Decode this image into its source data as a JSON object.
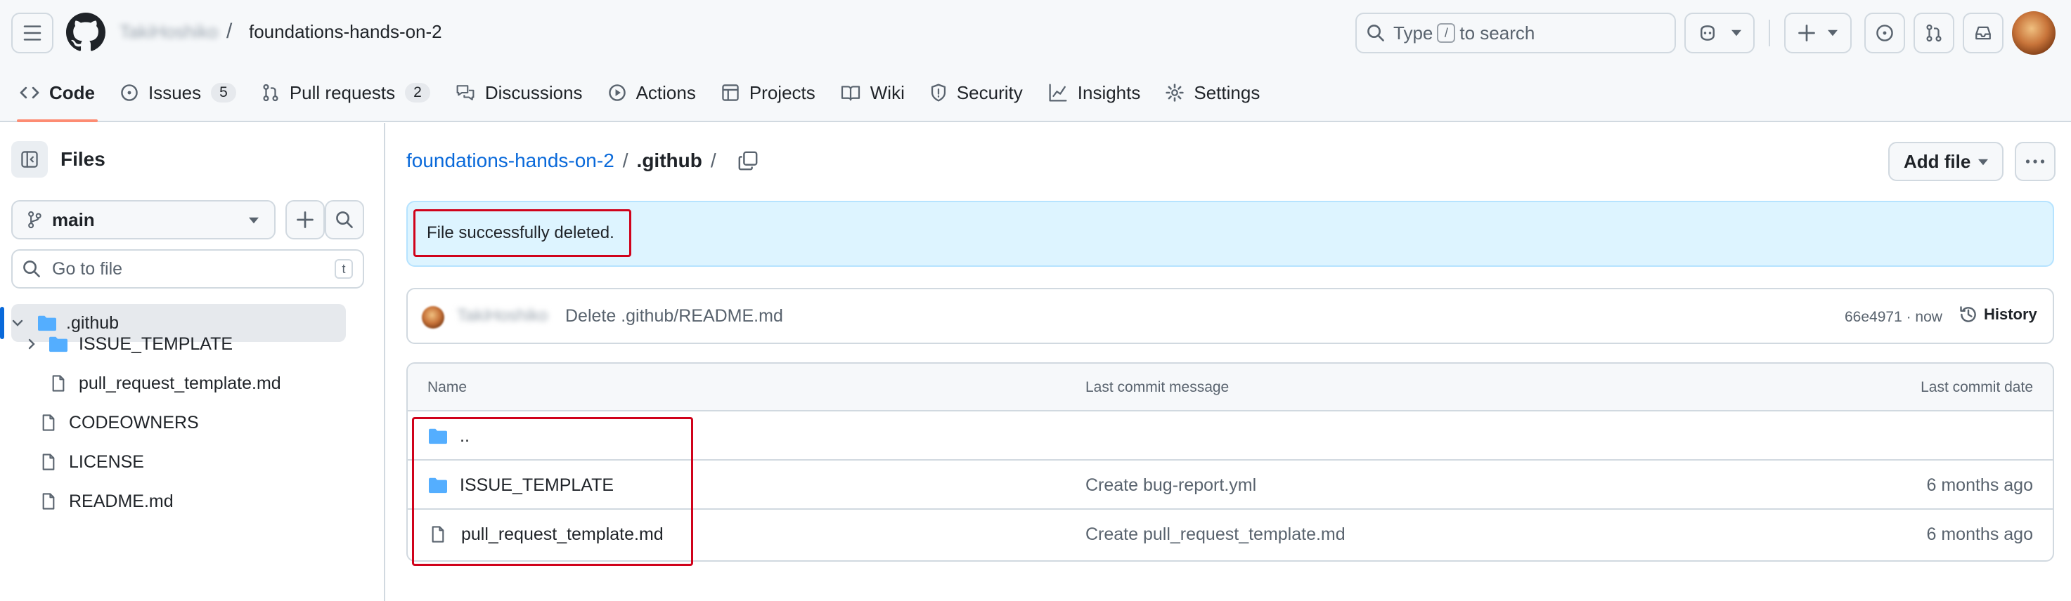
{
  "header": {
    "owner": "TakiHoshiko",
    "repo": "foundations-hands-on-2",
    "search_prefix": "Type",
    "search_key": "/",
    "search_suffix": "to search"
  },
  "tabs": [
    {
      "label": "Code",
      "icon": "code-icon",
      "active": true
    },
    {
      "label": "Issues",
      "icon": "issue-opened-icon",
      "count": "5"
    },
    {
      "label": "Pull requests",
      "icon": "git-pull-request-icon",
      "count": "2"
    },
    {
      "label": "Discussions",
      "icon": "comment-discussion-icon"
    },
    {
      "label": "Actions",
      "icon": "play-icon"
    },
    {
      "label": "Projects",
      "icon": "table-icon"
    },
    {
      "label": "Wiki",
      "icon": "book-icon"
    },
    {
      "label": "Security",
      "icon": "shield-icon"
    },
    {
      "label": "Insights",
      "icon": "graph-icon"
    },
    {
      "label": "Settings",
      "icon": "gear-icon"
    }
  ],
  "sidebar": {
    "title": "Files",
    "branch": "main",
    "goto_placeholder": "Go to file",
    "goto_key": "t",
    "tree": [
      {
        "label": ".github",
        "type": "folder",
        "expanded": true,
        "selected": true
      },
      {
        "label": "ISSUE_TEMPLATE",
        "type": "folder",
        "expanded": false
      },
      {
        "label": "pull_request_template.md",
        "type": "file"
      },
      {
        "label": "CODEOWNERS",
        "type": "file"
      },
      {
        "label": "LICENSE",
        "type": "file"
      },
      {
        "label": "README.md",
        "type": "file"
      }
    ]
  },
  "main": {
    "breadcrumb_root": "foundations-hands-on-2",
    "breadcrumb_sep": "/",
    "breadcrumb_current": ".github",
    "add_file_label": "Add file",
    "flash_message": "File successfully deleted.",
    "commit": {
      "author": "TakiHoshiko",
      "message": "Delete .github/README.md",
      "meta": "66e4971 · now",
      "history_label": "History"
    },
    "table": {
      "headers": [
        "Name",
        "Last commit message",
        "Last commit date"
      ],
      "rows": [
        {
          "name": "..",
          "type": "folder",
          "message": "",
          "date": ""
        },
        {
          "name": "ISSUE_TEMPLATE",
          "type": "folder",
          "message": "Create bug-report.yml",
          "date": "6 months ago"
        },
        {
          "name": "pull_request_template.md",
          "type": "file",
          "message": "Create pull_request_template.md",
          "date": "6 months ago"
        }
      ]
    }
  },
  "colors": {
    "accent": "#0969da",
    "tab_underline": "#fd8c73",
    "flash_bg": "#ddf4ff",
    "highlight_box": "#d0021b",
    "folder": "#54aeff"
  }
}
